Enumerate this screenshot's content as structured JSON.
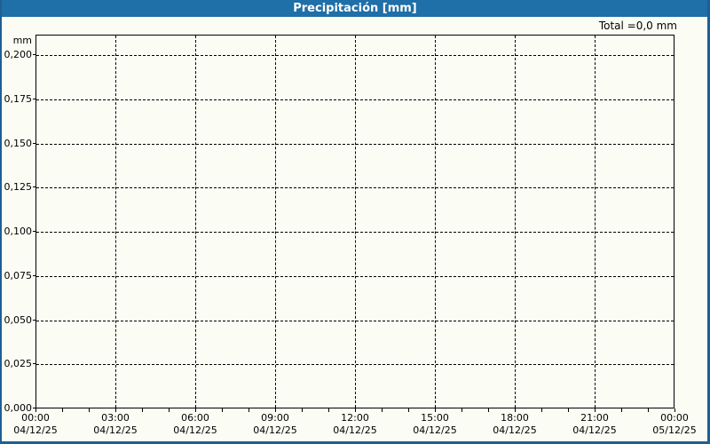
{
  "header": {
    "title": "Precipitación [mm]"
  },
  "summary": {
    "total_label": "Total =0,0 mm"
  },
  "colors": {
    "titlebar_bg": "#1f6fa8",
    "frame_border": "#1e5f95",
    "background": "#fbfdf4",
    "grid": "#000000",
    "axis_text": "#000000",
    "title_text": "#ffffff"
  },
  "chart_data": {
    "type": "line",
    "title": "Precipitación [mm]",
    "ylabel": "mm",
    "unit": "mm",
    "total": "0,0 mm",
    "grid": true,
    "ylim": [
      0,
      0.2
    ],
    "y_ticks": [
      {
        "value": 0.2,
        "label": "0,200"
      },
      {
        "value": 0.175,
        "label": "0,175"
      },
      {
        "value": 0.15,
        "label": "0,150"
      },
      {
        "value": 0.125,
        "label": "0,125"
      },
      {
        "value": 0.1,
        "label": "0,100"
      },
      {
        "value": 0.075,
        "label": "0,075"
      },
      {
        "value": 0.05,
        "label": "0,050"
      },
      {
        "value": 0.025,
        "label": "0,025"
      },
      {
        "value": 0.0,
        "label": "0,000"
      }
    ],
    "x_ticks": [
      {
        "time": "00:00",
        "date": "04/12/25"
      },
      {
        "time": "03:00",
        "date": "04/12/25"
      },
      {
        "time": "06:00",
        "date": "04/12/25"
      },
      {
        "time": "09:00",
        "date": "04/12/25"
      },
      {
        "time": "12:00",
        "date": "04/12/25"
      },
      {
        "time": "15:00",
        "date": "04/12/25"
      },
      {
        "time": "18:00",
        "date": "04/12/25"
      },
      {
        "time": "21:00",
        "date": "04/12/25"
      },
      {
        "time": "00:00",
        "date": "05/12/25"
      }
    ],
    "x_minor_tick_interval_hours": 1,
    "x_hours_total": 24,
    "series": [
      {
        "name": "Precipitación",
        "values": [
          0,
          0,
          0,
          0,
          0,
          0,
          0,
          0,
          0
        ]
      }
    ]
  }
}
